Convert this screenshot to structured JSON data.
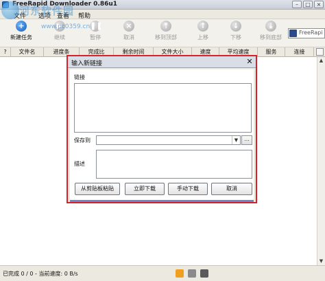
{
  "window": {
    "title": "FreeRapid Downloader 0.86u1",
    "minimize": "–",
    "maximize": "□",
    "close": "×"
  },
  "menu": {
    "items": [
      "文件",
      "选项",
      "查看",
      "帮助"
    ]
  },
  "watermark": {
    "name": "河东软件园",
    "url": "www.pc0359.cn"
  },
  "toolbar": {
    "buttons": [
      {
        "label": "新建任务",
        "icon": "plus-icon",
        "enabled": true
      },
      {
        "label": "继续",
        "icon": "play-icon",
        "enabled": false
      },
      {
        "label": "暂停",
        "icon": "pause-icon",
        "enabled": false
      },
      {
        "label": "取消",
        "icon": "cancel-icon",
        "enabled": false
      },
      {
        "label": "移到顶部",
        "icon": "top-icon",
        "enabled": false
      },
      {
        "label": "上移",
        "icon": "up-icon",
        "enabled": false
      },
      {
        "label": "下移",
        "icon": "down-icon",
        "enabled": false
      },
      {
        "label": "移到底部",
        "icon": "bottom-icon",
        "enabled": false
      }
    ],
    "search": {
      "text": "FreeRapi",
      "icon": "search-icon"
    }
  },
  "table": {
    "columns": [
      "?",
      "文件名",
      "进度条",
      "完成比",
      "剩余时间",
      "文件大小",
      "速度",
      "平均速度",
      "服务",
      "连接"
    ]
  },
  "dialog": {
    "title": "输入新链接",
    "links_label": "链接",
    "save_to_label": "保存到",
    "browse_label": "...",
    "description_label": "描述",
    "buttons": {
      "from_clipboard": "从剪贴板粘贴",
      "download_now": "立即下载",
      "manual_download": "手动下载",
      "cancel": "取消"
    }
  },
  "status": {
    "text": "已完成 0 / 0 - 当前速度: 0 B/s"
  },
  "colors": {
    "highlight_border": "#d8202a",
    "accent_blue": "#1459b3"
  }
}
